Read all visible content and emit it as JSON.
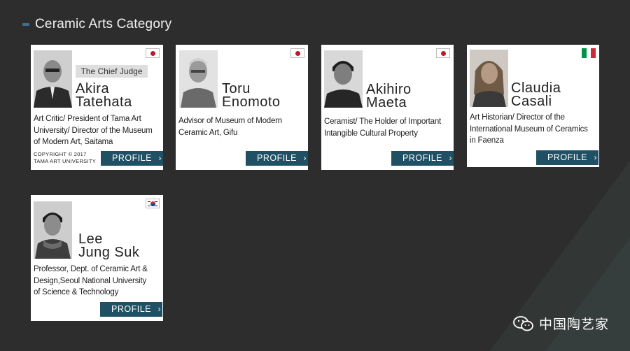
{
  "section": {
    "title": "Ceramic Arts Category"
  },
  "cards": [
    {
      "badge": "The Chief Judge",
      "name_line1": "Akira",
      "name_line2": "Tatehata",
      "desc_line1": "Art Critic/ President of Tama Art",
      "desc_line2": "University/ Director of the Museum",
      "desc_line3": "of Modern Art, Saitama",
      "copyright_line1": "COPYRIGHT © 2017",
      "copyright_line2": "TAMA ART UNIVERSITY",
      "flag": "japan-flag-icon",
      "button": "PROFILE"
    },
    {
      "name_line1": "Toru",
      "name_line2": "Enomoto",
      "desc_line1": "Advisor of Museum of Modern",
      "desc_line2": "Ceramic Art, Gifu",
      "flag": "japan-flag-icon",
      "button": "PROFILE"
    },
    {
      "name_line1": "Akihiro",
      "name_line2": "Maeta",
      "desc_line1": "Ceramist/ The Holder of Important",
      "desc_line2": "Intangible Cultural Property",
      "flag": "japan-flag-icon",
      "button": "PROFILE"
    },
    {
      "name_line1": "Claudia",
      "name_line2": "Casali",
      "desc_line1": "Art Historian/ Director of the",
      "desc_line2": "International Museum of Ceramics",
      "desc_line3": "in Faenza",
      "flag": "italy-flag-icon",
      "button": "PROFILE"
    },
    {
      "name_line1": "Lee",
      "name_line2": "Jung Suk",
      "desc_line1": "Professor, Dept. of Ceramic Art &",
      "desc_line2": "Design,Seoul National University",
      "desc_line3": "of Science & Technology",
      "flag": "korea-flag-icon",
      "button": "PROFILE"
    }
  ],
  "watermark": {
    "text": "中国陶艺家",
    "icon": "wechat-icon"
  },
  "colors": {
    "background": "#2d2d2e",
    "button": "#1f5064",
    "card": "#ffffff",
    "accent": "#3f6f8a"
  }
}
